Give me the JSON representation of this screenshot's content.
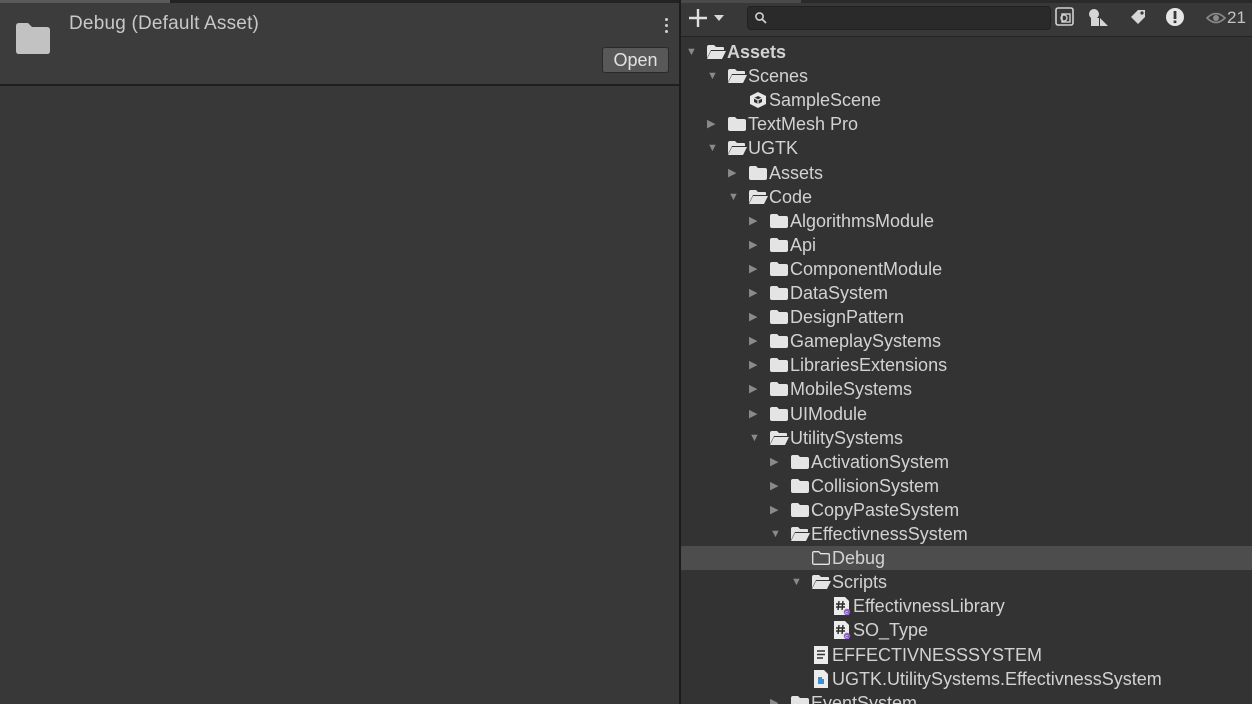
{
  "inspector": {
    "asset_title": "Debug (Default Asset)",
    "open_button": "Open"
  },
  "project": {
    "search": {
      "value": "",
      "placeholder": ""
    },
    "hidden_count": "21",
    "tree": [
      {
        "label": "Assets",
        "depth": 0,
        "expanded": true,
        "icon": "folder-open-icon",
        "bold": true
      },
      {
        "label": "Scenes",
        "depth": 1,
        "expanded": true,
        "icon": "folder-open-icon"
      },
      {
        "label": "SampleScene",
        "depth": 2,
        "icon": "unity-scene-icon"
      },
      {
        "label": "TextMesh Pro",
        "depth": 1,
        "expanded": false,
        "icon": "folder-icon"
      },
      {
        "label": "UGTK",
        "depth": 1,
        "expanded": true,
        "icon": "folder-open-icon"
      },
      {
        "label": "Assets",
        "depth": 2,
        "expanded": false,
        "icon": "folder-icon"
      },
      {
        "label": "Code",
        "depth": 2,
        "expanded": true,
        "icon": "folder-open-icon"
      },
      {
        "label": "AlgorithmsModule",
        "depth": 3,
        "expanded": false,
        "icon": "folder-icon"
      },
      {
        "label": "Api",
        "depth": 3,
        "expanded": false,
        "icon": "folder-icon"
      },
      {
        "label": "ComponentModule",
        "depth": 3,
        "expanded": false,
        "icon": "folder-icon"
      },
      {
        "label": "DataSystem",
        "depth": 3,
        "expanded": false,
        "icon": "folder-icon"
      },
      {
        "label": "DesignPattern",
        "depth": 3,
        "expanded": false,
        "icon": "folder-icon"
      },
      {
        "label": "GameplaySystems",
        "depth": 3,
        "expanded": false,
        "icon": "folder-icon"
      },
      {
        "label": "LibrariesExtensions",
        "depth": 3,
        "expanded": false,
        "icon": "folder-icon"
      },
      {
        "label": "MobileSystems",
        "depth": 3,
        "expanded": false,
        "icon": "folder-icon"
      },
      {
        "label": "UIModule",
        "depth": 3,
        "expanded": false,
        "icon": "folder-icon"
      },
      {
        "label": "UtilitySystems",
        "depth": 3,
        "expanded": true,
        "icon": "folder-open-icon"
      },
      {
        "label": "ActivationSystem",
        "depth": 4,
        "expanded": false,
        "icon": "folder-icon"
      },
      {
        "label": "CollisionSystem",
        "depth": 4,
        "expanded": false,
        "icon": "folder-icon"
      },
      {
        "label": "CopyPasteSystem",
        "depth": 4,
        "expanded": false,
        "icon": "folder-icon"
      },
      {
        "label": "EffectivnessSystem",
        "depth": 4,
        "expanded": true,
        "icon": "folder-open-icon"
      },
      {
        "label": "Debug",
        "depth": 5,
        "icon": "folder-empty-icon",
        "selected": true
      },
      {
        "label": "Scripts",
        "depth": 5,
        "expanded": true,
        "icon": "folder-open-icon"
      },
      {
        "label": "EffectivnessLibrary",
        "depth": 6,
        "icon": "csharp-script-icon"
      },
      {
        "label": "SO_Type",
        "depth": 6,
        "icon": "csharp-script-icon"
      },
      {
        "label": "EFFECTIVNESSSYSTEM",
        "depth": 5,
        "icon": "text-asset-icon"
      },
      {
        "label": "UGTK.UtilitySystems.EffectivnessSystem",
        "depth": 5,
        "icon": "assembly-definition-icon"
      },
      {
        "label": "EventSystem",
        "depth": 4,
        "expanded": false,
        "icon": "folder-icon"
      }
    ]
  }
}
